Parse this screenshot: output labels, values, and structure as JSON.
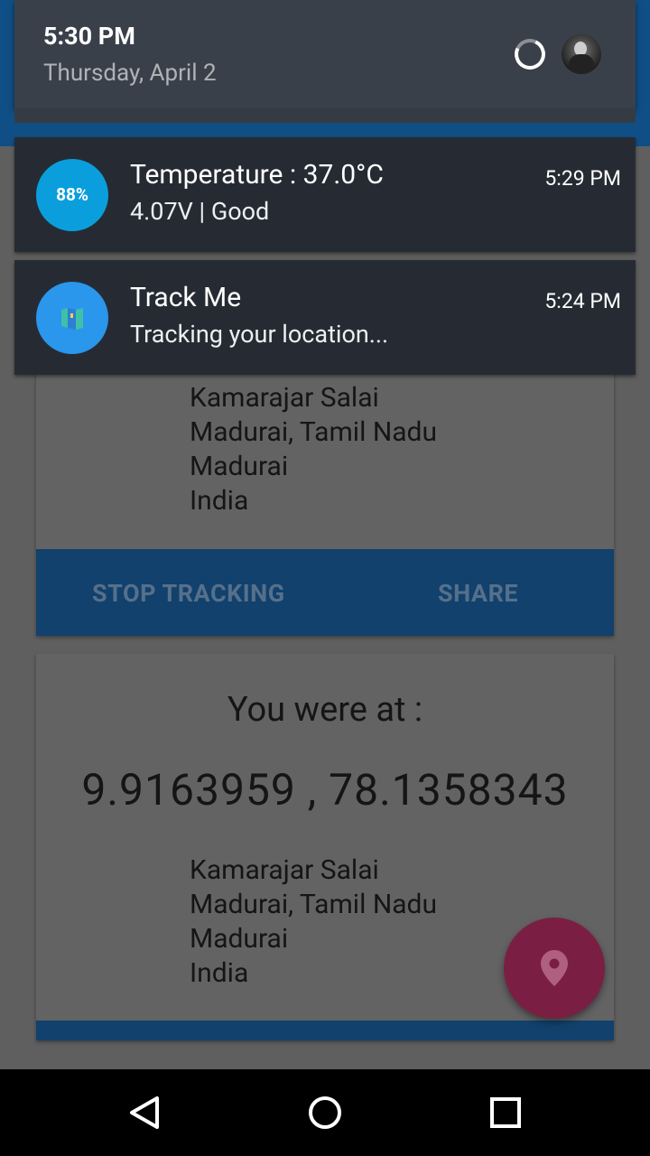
{
  "quick_settings": {
    "time": "5:30 PM",
    "date": "Thursday, April 2"
  },
  "notifications": [
    {
      "icon": "battery-percent-icon",
      "icon_label": "88%",
      "title": "Temperature : 37.0°C",
      "text": "4.07V  | Good",
      "time": "5:29 PM"
    },
    {
      "icon": "map-icon",
      "title": "Track Me",
      "text": "Tracking your location...",
      "time": "5:24 PM"
    }
  ],
  "tracking_card": {
    "address_lines": [
      "Kamarajar Salai",
      "Madurai, Tamil Nadu",
      "Madurai",
      "India"
    ],
    "buttons": {
      "stop": "STOP TRACKING",
      "share": "SHARE"
    }
  },
  "history_card": {
    "label": "You were at :",
    "coordinates": "9.9163959 , 78.1358343",
    "address_lines": [
      "Kamarajar Salai",
      "Madurai, Tamil Nadu",
      "Madurai",
      "India"
    ]
  },
  "fab": {
    "icon": "location-pin-icon"
  },
  "nav": {
    "back": "back-icon",
    "home": "home-icon",
    "recents": "recents-icon"
  },
  "colors": {
    "app_bar": "#0f4f86",
    "button_bar": "#11416c",
    "fab": "#7b1e44",
    "notification_bg": "#262b33",
    "battery_icon": "#0a9fdc",
    "map_icon_bg": "#2a96ec"
  }
}
